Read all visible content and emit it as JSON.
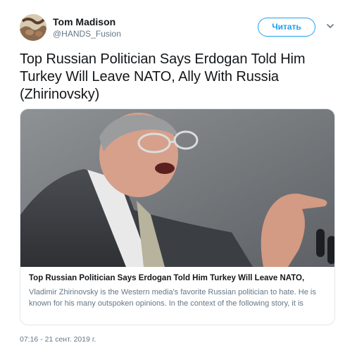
{
  "author": {
    "name": "Tom Madison",
    "handle": "@HANDS_Fusion"
  },
  "follow_button": {
    "label": "Читать"
  },
  "icons": {
    "menu": "chevron-down-icon",
    "avatar": "avatar-image"
  },
  "tweet": {
    "text": "Top Russian Politician Says Erdogan Told Him Turkey Will Leave NATO, Ally With Russia (Zhirinovsky)"
  },
  "card": {
    "title": "Top Russian Politician Says Erdogan Told Him Turkey Will Leave NATO,",
    "description": "Vladimir Zhirinovsky is the Western media's favorite Russian politician to hate. He is known for his many outspoken opinions. In the context of the following story, it is"
  },
  "timestamp": "07:16 - 21 сент. 2019 г.",
  "colors": {
    "accent": "#1da1f2",
    "text_primary": "#14171a",
    "text_secondary": "#657786",
    "border": "#e1e8ed"
  }
}
